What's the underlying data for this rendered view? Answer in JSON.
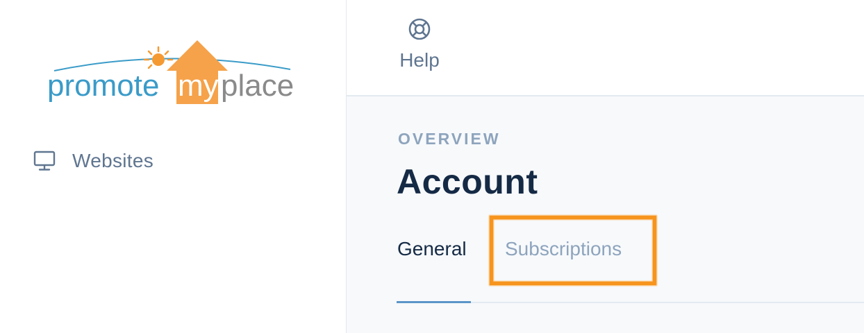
{
  "sidebar": {
    "logo": {
      "word_promote": "promote",
      "word_my": "my",
      "word_place": "place",
      "colors": {
        "blue": "#3a9bc8",
        "orange": "#f5a24a",
        "gray": "#8a8a8a",
        "sun": "#f59a33"
      }
    },
    "items": [
      {
        "label": "Websites",
        "icon": "monitor-icon"
      }
    ]
  },
  "topbar": {
    "help": {
      "label": "Help",
      "icon": "lifebuoy-icon"
    }
  },
  "main": {
    "overline": "OVERVIEW",
    "title": "Account",
    "tabs": [
      {
        "label": "General",
        "active": true
      },
      {
        "label": "Subscriptions",
        "active": false,
        "highlighted": true
      }
    ],
    "highlight_color": "#f7941d"
  }
}
